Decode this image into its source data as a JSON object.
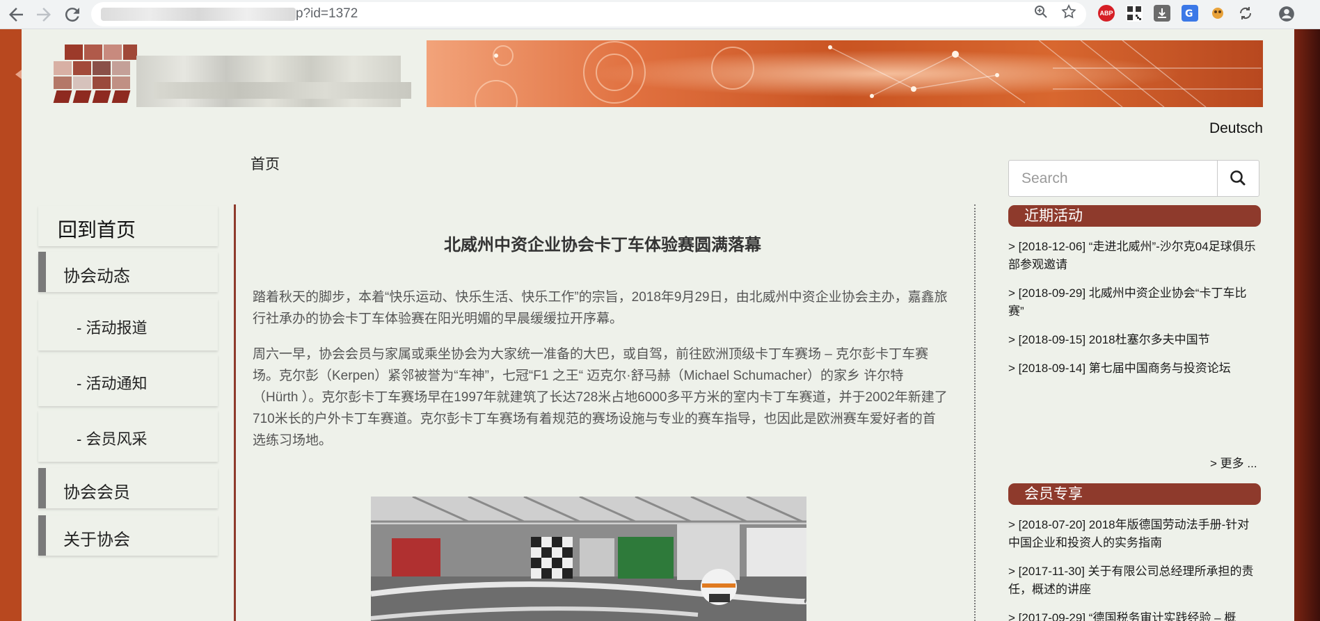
{
  "browser": {
    "url_visible": "p?id=1372",
    "back_icon": "arrow-left-icon",
    "forward_icon": "arrow-right-icon",
    "reload_icon": "reload-icon",
    "zoom_icon": "zoom-icon",
    "bookmark_icon": "star-icon",
    "extensions": [
      {
        "name": "adblock-icon",
        "label": "ABP",
        "color": "#d61f26"
      },
      {
        "name": "qr-code-icon",
        "label": "",
        "color": "#333333"
      },
      {
        "name": "download-icon",
        "label": "",
        "color": "#6b6b6b"
      },
      {
        "name": "translate-icon",
        "label": "",
        "color": "#3b78e7"
      },
      {
        "name": "tampermonkey-icon",
        "label": "",
        "color": "#e8a23a"
      },
      {
        "name": "sync-icon",
        "label": "",
        "color": "#555555"
      }
    ],
    "profile_icon": "profile-icon"
  },
  "header": {
    "language_link": "Deutsch",
    "nav_home": "首页"
  },
  "sidebar": {
    "back_home": "回到首页",
    "items": [
      {
        "label": "协会动态",
        "has_bar": true
      },
      {
        "label": "- 活动报道",
        "has_bar": false
      },
      {
        "label": "- 活动通知",
        "has_bar": false
      },
      {
        "label": "- 会员风采",
        "has_bar": false
      },
      {
        "label": "协会会员",
        "has_bar": true
      },
      {
        "label": "关于协会",
        "has_bar": true
      }
    ]
  },
  "article": {
    "title": "北威州中资企业协会卡丁车体验赛圆满落幕",
    "paragraphs": [
      "踏着秋天的脚步，本着“快乐运动、快乐生活、快乐工作”的宗旨，2018年9月29日，由北威州中资企业协会主办，嘉鑫旅行社承办的协会卡丁车体验赛在阳光明媚的早晨缓缓拉开序幕。",
      "周六一早，协会会员与家属或乘坐协会为大家统一准备的大巴，或自驾，前往欧洲顶级卡丁车赛场 – 克尔彭卡丁车赛场。克尔彭（Kerpen）紧邻被誉为“车神”，七冠“F1 之王“ 迈克尔·舒马赫（Michael Schumacher）的家乡 许尔特（Hürth ）。克尔彭卡丁车赛场早在1997年就建筑了长达728米占地6000多平方米的室内卡丁车赛道，并于2002年新建了710米长的户外卡丁车赛道。克尔彭卡丁车赛场有着规范的赛场设施与专业的赛车指导，也因此是欧洲赛车爱好者的首选练习场地。"
    ]
  },
  "search": {
    "placeholder": "Search",
    "button_icon": "search-icon"
  },
  "recent_events": {
    "heading": "近期活动",
    "items": [
      "> [2018-12-06] “走进北威州”-沙尔克04足球俱乐部参观邀请",
      "> [2018-09-29] 北威州中资企业协会“卡丁车比赛”",
      "> [2018-09-15] 2018杜塞尔多夫中国节",
      "> [2018-09-14] 第七届中国商务与投资论坛"
    ],
    "more": "> 更多 ..."
  },
  "member_exclusive": {
    "heading": "会员专享",
    "items": [
      "> [2018-07-20] 2018年版德国劳动法手册-针对中国企业和投资人的实务指南",
      "> [2017-11-30] 关于有限公司总经理所承担的责任，概述的讲座",
      "> [2017-09-29] “德国税务审计实践经验 – 概"
    ]
  },
  "colors": {
    "accent": "#8e3a2c",
    "frame_left": "#b8481f",
    "page_bg": "#eef1ea"
  }
}
